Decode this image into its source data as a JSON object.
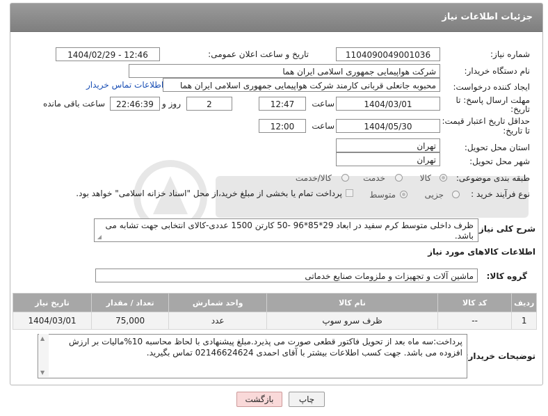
{
  "header": {
    "title": "جزئیات اطلاعات نیاز"
  },
  "fields": {
    "need_number": {
      "label": "شماره نیاز:",
      "value": "1104090049001036"
    },
    "announce": {
      "label": "تاریخ و ساعت اعلان عمومی:",
      "value": "1404/02/29 - 12:46"
    },
    "buyer_org": {
      "label": "نام دستگاه خریدار:",
      "value": "شرکت هواپیمایی جمهوری اسلامی ایران هما"
    },
    "creator": {
      "label": "ایجاد کننده درخواست:",
      "value": "محبوبه جانعلی قربانی کارمند شرکت هواپیمایی جمهوری اسلامی ایران هما",
      "contact_link": "اطلاعات تماس خریدار"
    },
    "deadline": {
      "label_line1": "مهلت ارسال پاسخ: تا",
      "label_line2": "تاریخ:",
      "date": "1404/03/01",
      "time_label": "ساعت",
      "time": "12:47",
      "days": "2",
      "days_label": "روز و",
      "remaining": "22:46:39",
      "remaining_label": "ساعت باقی مانده"
    },
    "validity": {
      "label_line1": "حداقل تاریخ اعتبار قیمت:",
      "label_line2": "تا تاریخ:",
      "date": "1404/05/30",
      "time_label": "ساعت",
      "time": "12:00"
    },
    "province": {
      "label": "استان محل تحویل:",
      "value": "تهران"
    },
    "city": {
      "label": "شهر محل تحویل:",
      "value": "تهران"
    },
    "category": {
      "label": "طبقه بندی موضوعی:",
      "options": [
        "کالا",
        "خدمت",
        "کالا/خدمت"
      ],
      "selected": "کالا"
    },
    "process": {
      "label": "نوع فرآیند خرید :",
      "options": [
        "جزیی",
        "متوسط"
      ],
      "selected": "متوسط",
      "checkbox_text": "پرداخت تمام یا بخشی از مبلغ خرید،از محل \"اسناد خزانه اسلامی\" خواهد بود."
    }
  },
  "description": {
    "label": "شرح کلی نیاز:",
    "text": "ظرف داخلی متوسط کرم سفید در ابعاد 29*85*96 -50 کارتن 1500 عددی-کالای انتخابی جهت تشابه می باشد."
  },
  "goods_section": {
    "title": "اطلاعات کالاهای مورد نیاز",
    "group_label": "گروه کالا:",
    "group_value": "ماشین آلات و تجهیزات و ملزومات صنایع خدماتی"
  },
  "table": {
    "headers": [
      "ردیف",
      "کد کالا",
      "نام کالا",
      "واحد شمارش",
      "تعداد / مقدار",
      "تاریخ نیاز"
    ],
    "rows": [
      [
        "1",
        "--",
        "ظرف سرو سوپ",
        "عدد",
        "75,000",
        "1404/03/01"
      ]
    ]
  },
  "buyer_notes": {
    "label": "توضیحات خریدار:",
    "text": "پرداخت:سه ماه بعد از تحویل فاکتور قطعی صورت می پذیرد.مبلغ پیشنهادی با لحاظ محاسبه 10%مالیات بر ارزش افزوده می باشد. جهت کسب اطلاعات بیشتر با آقای احمدی 02146624624 تماس بگیرید."
  },
  "buttons": {
    "print": "چاپ",
    "back": "بازگشت"
  },
  "colors": {
    "header_bg": "#8c8c8c",
    "link": "#1a4fb5",
    "back_button_bg": "#f9d9d9"
  }
}
